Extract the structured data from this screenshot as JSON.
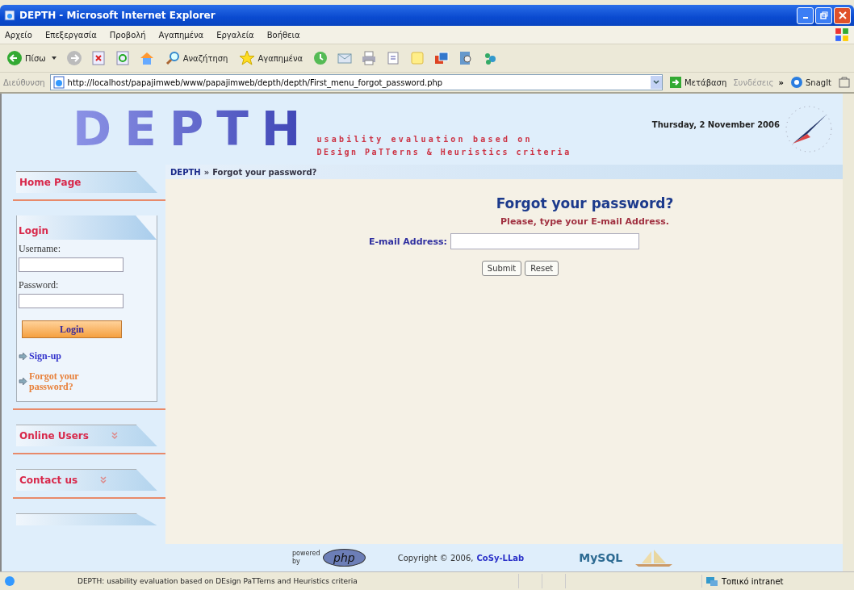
{
  "window": {
    "title": "DEPTH - Microsoft Internet Explorer"
  },
  "menu": [
    "Αρχείο",
    "Επεξεργασία",
    "Προβολή",
    "Αγαπημένα",
    "Εργαλεία",
    "Βοήθεια"
  ],
  "toolbar": {
    "back": "Πίσω",
    "search": "Αναζήτηση",
    "favorites": "Αγαπημένα"
  },
  "address": {
    "label": "Διεύθυνση",
    "url": "http://localhost/papajimweb/www/papajimweb/depth/depth/First_menu_forgot_password.php",
    "go": "Μετάβαση",
    "links": "Συνδέσεις",
    "more": "»",
    "snagit": "SnagIt"
  },
  "header": {
    "logo": "DEPTH",
    "tagline_1": "usability evaluation based on",
    "tagline_2": "DEsign PaTTerns & Heuristics criteria",
    "date": "Thursday, 2 November 2006"
  },
  "sidebar": {
    "home": "Home Page",
    "login": {
      "title": "Login",
      "username_label": "Username:",
      "password_label": "Password:",
      "button": "Login",
      "links": [
        {
          "label": "Sign-up",
          "hover": false
        },
        {
          "label": "Forgot your password?",
          "hover": true
        }
      ]
    },
    "sections": [
      {
        "label": "Online Users"
      },
      {
        "label": "Contact us"
      }
    ]
  },
  "breadcrumb": {
    "root": "DEPTH",
    "sep": "»",
    "current": "Forgot your password?"
  },
  "form": {
    "title": "Forgot your password?",
    "instruction": "Please, type your E-mail Address.",
    "field_label": "E-mail Address:",
    "buttons": [
      "Submit",
      "Reset"
    ]
  },
  "footer": {
    "powered": "powered by",
    "php": "php",
    "copyright": "Copyright © 2006,",
    "lab": "CoSy-LLab",
    "mysql": "MySQL"
  },
  "status_bar": {
    "text": "DEPTH: usability evaluation based on DEsign PaTTerns and Heuristics criteria",
    "zone": "Τοπικό intranet"
  }
}
